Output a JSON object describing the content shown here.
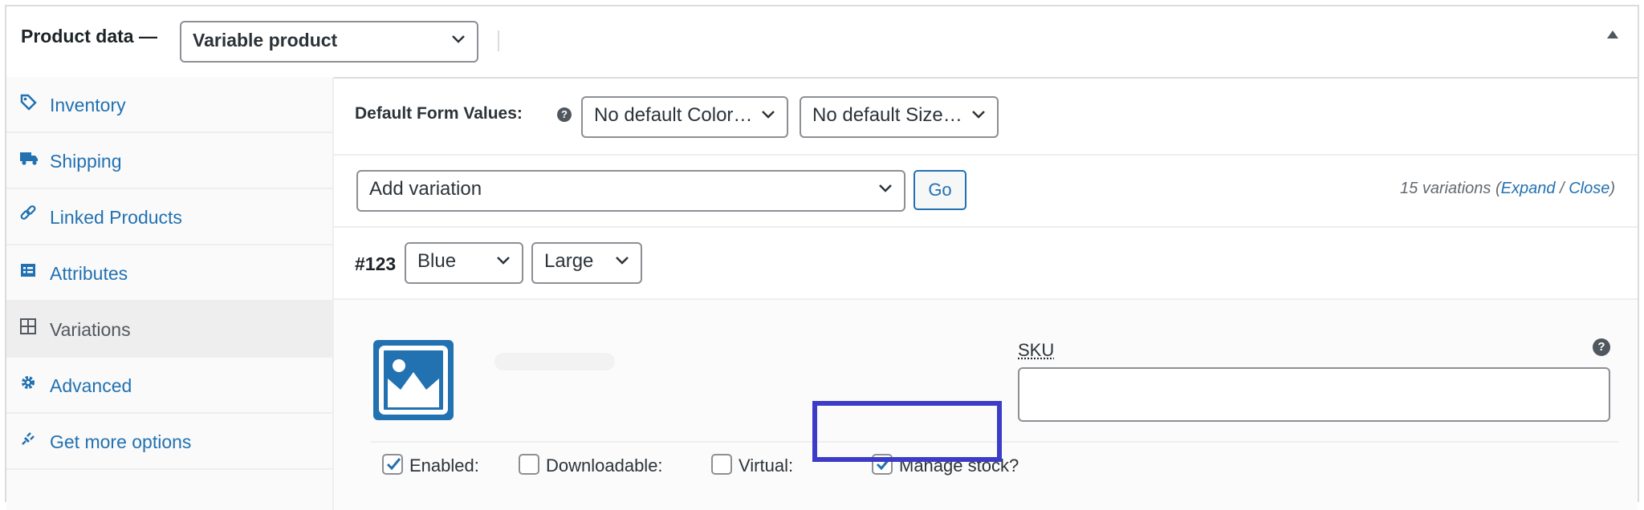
{
  "header": {
    "title": "Product data —",
    "product_type": "Variable product"
  },
  "sidebar": {
    "items": [
      {
        "label": "Inventory",
        "icon": "tag-icon"
      },
      {
        "label": "Shipping",
        "icon": "truck-icon"
      },
      {
        "label": "Linked Products",
        "icon": "link-icon"
      },
      {
        "label": "Attributes",
        "icon": "list-icon"
      },
      {
        "label": "Variations",
        "icon": "grid-icon",
        "active": true
      },
      {
        "label": "Advanced",
        "icon": "gear-icon"
      },
      {
        "label": "Get more options",
        "icon": "plugin-icon"
      }
    ]
  },
  "defaults": {
    "label": "Default Form Values:",
    "color_select": "No default Color…",
    "size_select": "No default Size…"
  },
  "add_variation": {
    "select": "Add variation",
    "go_label": "Go",
    "count_text": "15 variations",
    "open_paren": "(",
    "expand_label": "Expand",
    "slash": "/",
    "close_label": "Close",
    "close_paren": ")"
  },
  "variation": {
    "id": "#123",
    "color": "Blue",
    "size": "Large",
    "sku_label": "SKU",
    "sku_value": "",
    "options": {
      "enabled": {
        "label": "Enabled:",
        "checked": true
      },
      "downloadable": {
        "label": "Downloadable:",
        "checked": false
      },
      "virtual": {
        "label": "Virtual:",
        "checked": false
      },
      "manage_stock": {
        "label": "Manage stock?",
        "checked": true
      }
    }
  },
  "colors": {
    "link": "#2271b1",
    "highlight": "#3c3cc8"
  }
}
